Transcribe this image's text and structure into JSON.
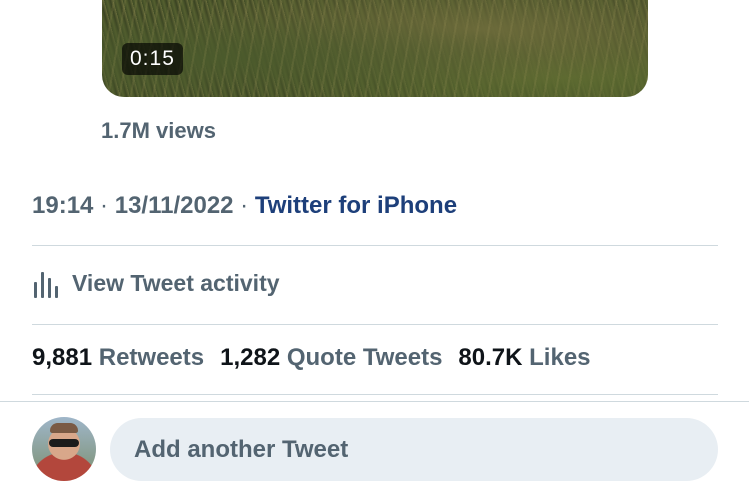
{
  "video": {
    "duration": "0:15"
  },
  "views": "1.7M views",
  "meta": {
    "time": "19:14",
    "dot1": " · ",
    "date": "13/11/2022",
    "dot2": " · ",
    "source": "Twitter for iPhone"
  },
  "activity": {
    "label": "View Tweet activity",
    "icon": "bar-chart-icon"
  },
  "stats": {
    "retweets_count": "9,881",
    "retweets_label": "Retweets",
    "quotes_count": "1,282",
    "quotes_label": "Quote Tweets",
    "likes_count": "80.7K",
    "likes_label": "Likes"
  },
  "compose": {
    "placeholder": "Add another Tweet"
  },
  "colors": {
    "secondary_text": "#536471",
    "link": "#1d3f7a",
    "divider": "#cfd9de",
    "compose_bg": "#e8eef3"
  }
}
